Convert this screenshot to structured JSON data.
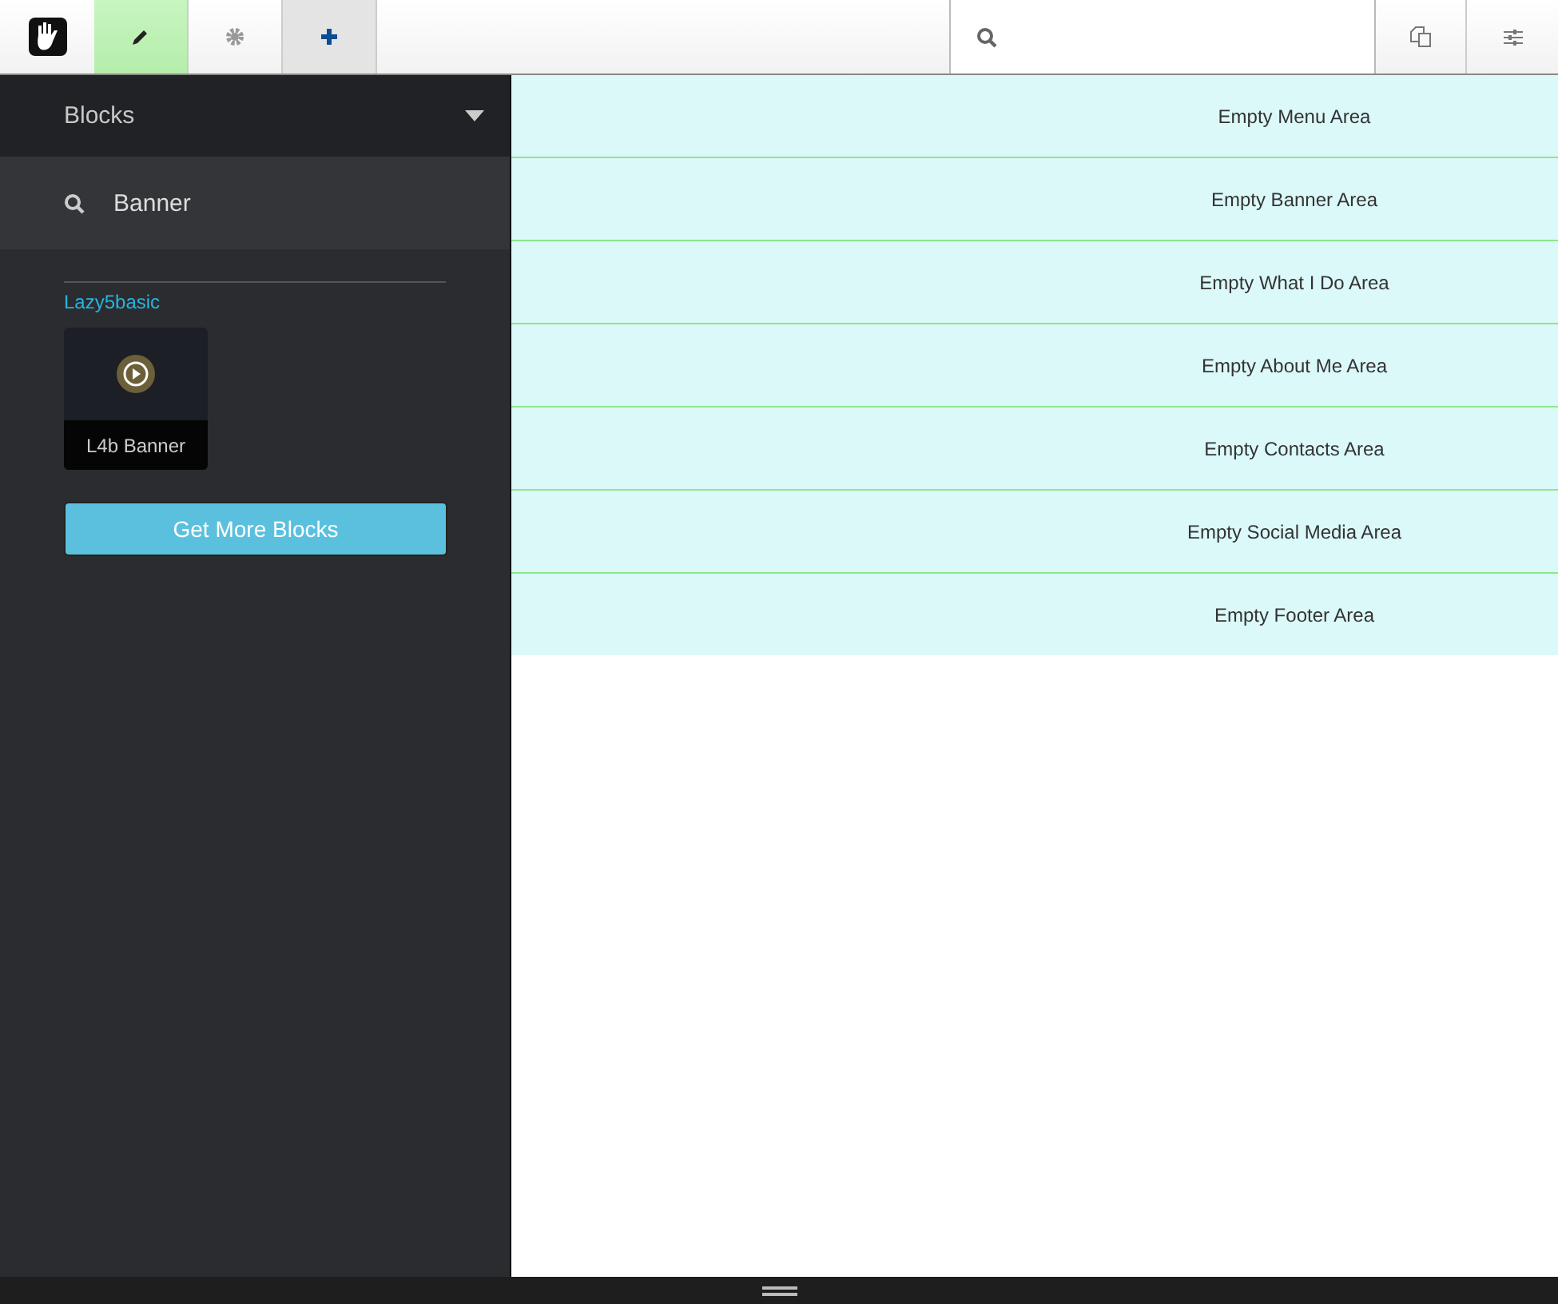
{
  "toolbar": {
    "tools": [
      {
        "kind": "edit",
        "selected": true
      },
      {
        "kind": "settings",
        "selected": false
      },
      {
        "kind": "add",
        "selected": false,
        "panel_open": true
      }
    ]
  },
  "panel": {
    "title": "Blocks",
    "search": {
      "value": "Banner"
    },
    "groups": [
      {
        "name": "Lazy5basic",
        "blocks": [
          {
            "label": "L4b Banner"
          }
        ]
      }
    ],
    "more_button": "Get More Blocks"
  },
  "areas": [
    "Empty Menu Area",
    "Empty Banner Area",
    "Empty What I Do Area",
    "Empty About Me Area",
    "Empty Contacts Area",
    "Empty Social Media Area",
    "Empty Footer Area"
  ]
}
